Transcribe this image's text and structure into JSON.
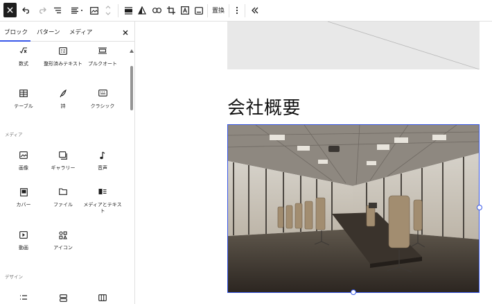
{
  "toolbar": {
    "replace_label": "置換"
  },
  "sidebar": {
    "tabs": [
      {
        "label": "ブロック",
        "active": true
      },
      {
        "label": "パターン",
        "active": false
      },
      {
        "label": "メディア",
        "active": false
      }
    ],
    "row1": [
      {
        "label": "数式",
        "icon": "math-icon"
      },
      {
        "label": "整形済みテキスト",
        "icon": "preformatted-icon"
      },
      {
        "label": "プルクオート",
        "icon": "pullquote-icon"
      }
    ],
    "row2": [
      {
        "label": "テーブル",
        "icon": "table-icon"
      },
      {
        "label": "詩",
        "icon": "verse-icon"
      },
      {
        "label": "クラシック",
        "icon": "classic-icon"
      }
    ],
    "media_heading": "メディア",
    "media_row1": [
      {
        "label": "画像",
        "icon": "image-icon"
      },
      {
        "label": "ギャラリー",
        "icon": "gallery-icon"
      },
      {
        "label": "音声",
        "icon": "audio-icon"
      }
    ],
    "media_row2": [
      {
        "label": "カバー",
        "icon": "cover-icon"
      },
      {
        "label": "ファイル",
        "icon": "file-icon"
      },
      {
        "label": "メディアとテキスト",
        "icon": "media-text-icon"
      }
    ],
    "media_row3": [
      {
        "label": "動画",
        "icon": "video-icon"
      },
      {
        "label": "アイコン",
        "icon": "icon-block-icon"
      }
    ],
    "design_heading": "デザイン"
  },
  "canvas": {
    "heading": "会社概要"
  },
  "colors": {
    "accent": "#3858e9",
    "dark": "#1e1e1e"
  }
}
